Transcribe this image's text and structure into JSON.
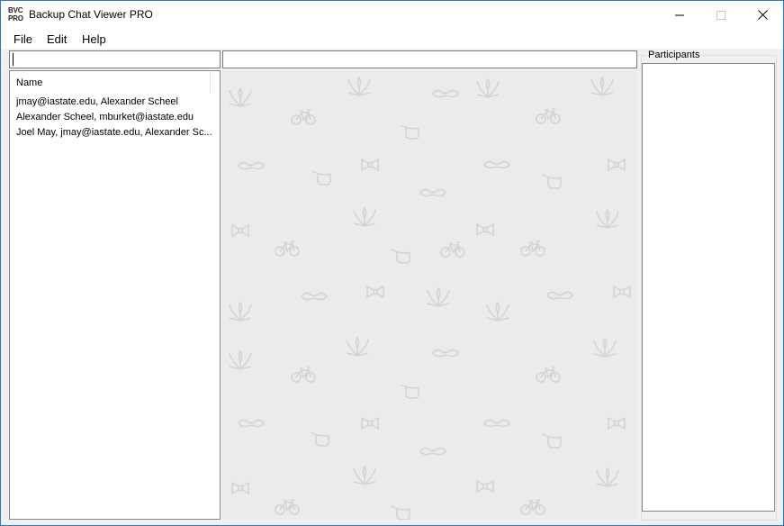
{
  "window": {
    "logo_line1": "BVC",
    "logo_line2": "PRO",
    "title": "Backup Chat Viewer PRO",
    "controls": {
      "minimize": "minimize-icon",
      "maximize": "maximize-icon",
      "close": "close-icon"
    }
  },
  "menu": [
    "File",
    "Edit",
    "Help"
  ],
  "search": {
    "value": ""
  },
  "message_input": {
    "value": ""
  },
  "chat_list": {
    "column_header": "Name",
    "rows": [
      "jmay@iastate.edu, Alexander Scheel",
      "Alexander Scheel, mburket@iastate.edu",
      "Joel May, jmay@iastate.edu, Alexander Sc..."
    ]
  },
  "participants": {
    "label": "Participants",
    "items": []
  },
  "colors": {
    "chat_background": "#ebebeb",
    "pattern": "#d3d3d3",
    "border_accent": "#2b79c2"
  }
}
